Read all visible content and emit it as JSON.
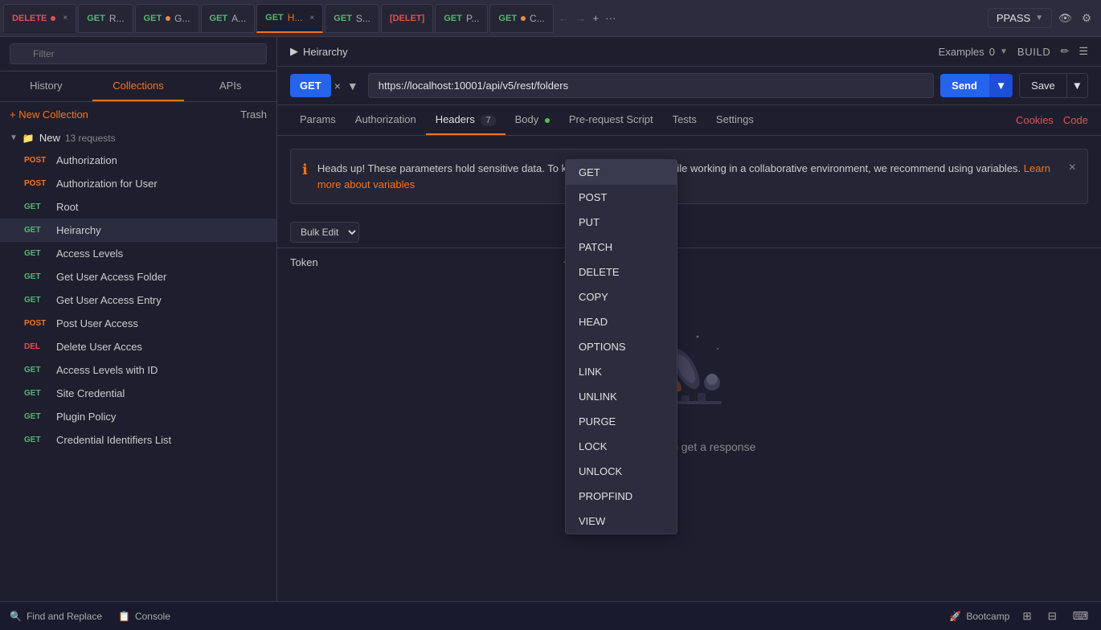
{
  "topbar": {
    "tabs": [
      {
        "id": "delete",
        "method": "DELETE",
        "label": "DELETE",
        "dot": "red",
        "active": false
      },
      {
        "id": "get-r",
        "method": "GET",
        "label": "GET R...",
        "dot": "none",
        "active": false
      },
      {
        "id": "get-g",
        "method": "GET",
        "label": "GET G...",
        "dot": "orange",
        "active": false
      },
      {
        "id": "get-a",
        "method": "GET",
        "label": "GET A...",
        "dot": "none",
        "active": false
      },
      {
        "id": "get-h",
        "method": "GET",
        "label": "GET H...",
        "dot": "none",
        "active": true
      },
      {
        "id": "get-s",
        "method": "GET",
        "label": "GET S...",
        "dot": "none",
        "active": false
      },
      {
        "id": "delete2",
        "method": "DEL",
        "label": "[DELET]",
        "dot": "none",
        "active": false
      },
      {
        "id": "get-p",
        "method": "GET",
        "label": "GET P...",
        "dot": "none",
        "active": false
      },
      {
        "id": "get-c",
        "method": "GET",
        "label": "GET C...",
        "dot": "orange",
        "active": false
      }
    ]
  },
  "env_selector": {
    "value": "PPASS",
    "label": "PPASS"
  },
  "sidebar": {
    "filter_placeholder": "Filter",
    "tabs": [
      "History",
      "Collections",
      "APIs"
    ],
    "active_tab": "Collections",
    "new_collection_label": "+ New Collection",
    "trash_label": "Trash",
    "collection": {
      "name": "New",
      "count": "13 requests",
      "requests": [
        {
          "method": "POST",
          "label": "Authorization",
          "active": false
        },
        {
          "method": "POST",
          "label": "Authorization for User",
          "active": false
        },
        {
          "method": "GET",
          "label": "Root",
          "active": false
        },
        {
          "method": "GET",
          "label": "Heirarchy",
          "active": true
        },
        {
          "method": "GET",
          "label": "Access Levels",
          "active": false
        },
        {
          "method": "GET",
          "label": "Get User Access Folder",
          "active": false
        },
        {
          "method": "GET",
          "label": "Get User Access Entry",
          "active": false
        },
        {
          "method": "POST",
          "label": "Post User Access",
          "active": false
        },
        {
          "method": "DEL",
          "label": "Delete User Acces",
          "active": false
        },
        {
          "method": "GET",
          "label": "Access Levels with ID",
          "active": false
        },
        {
          "method": "GET",
          "label": "Site Credential",
          "active": false
        },
        {
          "method": "GET",
          "label": "Plugin Policy",
          "active": false
        },
        {
          "method": "GET",
          "label": "Credential Identifiers List",
          "active": false
        }
      ]
    }
  },
  "breadcrumb": {
    "label": "Heirarchy",
    "examples_label": "Examples",
    "examples_count": "0",
    "build_label": "BUILD"
  },
  "url_bar": {
    "method": "GET",
    "url": "https://localhost:10001/api/v5/rest/folders",
    "send_label": "Send",
    "save_label": "Save"
  },
  "request_tabs": [
    {
      "id": "params",
      "label": "Params"
    },
    {
      "id": "authorization",
      "label": "Authorization"
    },
    {
      "id": "headers",
      "label": "Headers",
      "badge": "7",
      "active": true
    },
    {
      "id": "body",
      "label": "Body",
      "dot": true
    },
    {
      "id": "pre-request",
      "label": "Pre-request Script"
    },
    {
      "id": "tests",
      "label": "Tests"
    },
    {
      "id": "settings",
      "label": "Settings"
    }
  ],
  "cookies_code": {
    "cookies_label": "Cookies",
    "code_label": "Code"
  },
  "alert": {
    "text": "Heads up! These parameters hold sensitive data. To keep this data secure while working in a collaborative environment, we recommend using variables.",
    "link_text": "Learn more about variables"
  },
  "param_rows": [
    {
      "key": "Token",
      "value": "{{authorization}}"
    }
  ],
  "dropdown": {
    "items": [
      "GET",
      "POST",
      "PUT",
      "PATCH",
      "DELETE",
      "COPY",
      "HEAD",
      "OPTIONS",
      "LINK",
      "UNLINK",
      "PURGE",
      "LOCK",
      "UNLOCK",
      "PROPFIND",
      "VIEW"
    ]
  },
  "empty_state": {
    "text": "Hit Send to get a response"
  },
  "bottom_bar": {
    "find_replace": "Find and Replace",
    "console": "Console",
    "bootcamp": "Bootcamp"
  }
}
